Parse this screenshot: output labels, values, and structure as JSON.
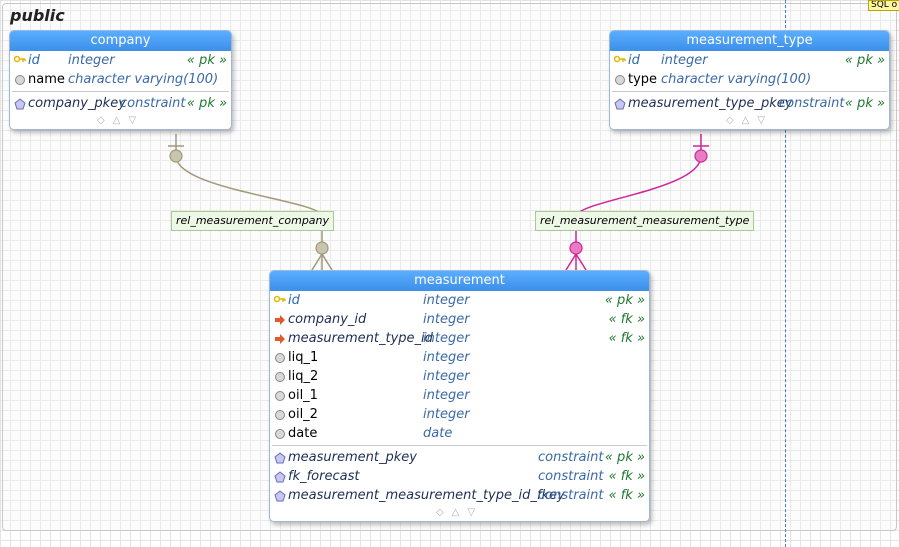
{
  "schema": {
    "name": "public"
  },
  "badge": {
    "text": "SQL o"
  },
  "tables": {
    "company": {
      "title": "company",
      "columns": [
        {
          "name": "id",
          "type": "integer",
          "key": "« pk »",
          "kind": "pk"
        },
        {
          "name": "name",
          "type": "character varying(100)",
          "key": "",
          "kind": "col"
        }
      ],
      "constraints": [
        {
          "name": "company_pkey",
          "type": "constraint",
          "key": "« pk »"
        }
      ]
    },
    "measurement_type": {
      "title": "measurement_type",
      "columns": [
        {
          "name": "id",
          "type": "integer",
          "key": "« pk »",
          "kind": "pk"
        },
        {
          "name": "type",
          "type": "character varying(100)",
          "key": "",
          "kind": "col"
        }
      ],
      "constraints": [
        {
          "name": "measurement_type_pkey",
          "type": "constraint",
          "key": "« pk »"
        }
      ]
    },
    "measurement": {
      "title": "measurement",
      "columns": [
        {
          "name": "id",
          "type": "integer",
          "key": "« pk »",
          "kind": "pk"
        },
        {
          "name": "company_id",
          "type": "integer",
          "key": "« fk »",
          "kind": "fk"
        },
        {
          "name": "measurement_type_id",
          "type": "integer",
          "key": "« fk »",
          "kind": "fk"
        },
        {
          "name": "liq_1",
          "type": "integer",
          "key": "",
          "kind": "col"
        },
        {
          "name": "liq_2",
          "type": "integer",
          "key": "",
          "kind": "col"
        },
        {
          "name": "oil_1",
          "type": "integer",
          "key": "",
          "kind": "col"
        },
        {
          "name": "oil_2",
          "type": "integer",
          "key": "",
          "kind": "col"
        },
        {
          "name": "date",
          "type": "date",
          "key": "",
          "kind": "col"
        }
      ],
      "constraints": [
        {
          "name": "measurement_pkey",
          "type": "constraint",
          "key": "« pk »"
        },
        {
          "name": "fk_forecast",
          "type": "constraint",
          "key": "« fk »"
        },
        {
          "name": "measurement_measurement_type_id_fkey",
          "type": "constraint",
          "key": "« fk »"
        }
      ]
    }
  },
  "relations": [
    {
      "label": "rel_measurement_company",
      "color": "#a09a7a"
    },
    {
      "label": "rel_measurement_measurement_type",
      "color": "#d0259a"
    }
  ],
  "colors": {
    "header": "#4a9ef5",
    "pk_key": "#1e7a2e",
    "type": "#3a6aa8",
    "fk_arrow": "#e05a2a",
    "pk_icon": "#e0b800"
  }
}
